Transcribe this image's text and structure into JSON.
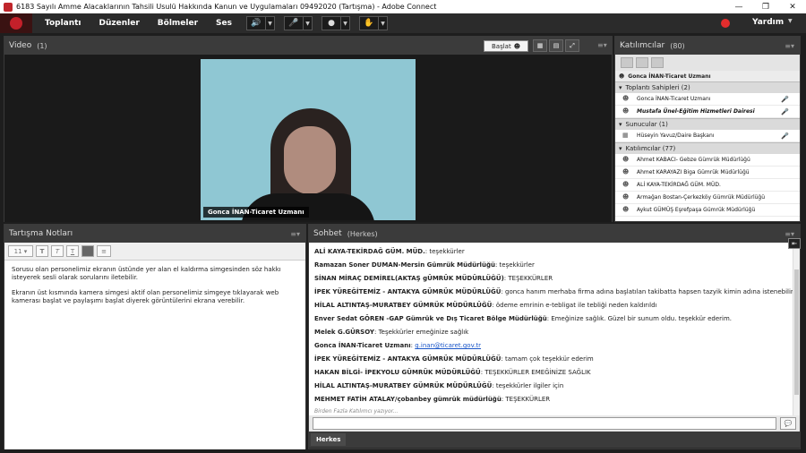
{
  "window": {
    "title": "6183 Sayılı Amme Alacaklarının Tahsili Usulü Hakkında Kanun ve Uygulamaları 09492020 (Tartışma) - Adobe Connect"
  },
  "menu": {
    "items": [
      "Toplantı",
      "Düzenler",
      "Bölmeler",
      "Ses"
    ],
    "help": "Yardım"
  },
  "video": {
    "title": "Video",
    "count": "(1)",
    "start": "Başlat",
    "label": "Gonca İNAN-Ticaret Uzmanı"
  },
  "attendees": {
    "title": "Katılımcılar",
    "count": "(80)",
    "top_name": "Gonca İNAN-Ticaret Uzmanı",
    "hosts_title": "Toplantı Sahipleri (2)",
    "hosts": [
      "Gonca İNAN-Ticaret Uzmanı",
      "Mustafa Ünel-Eğitim Hizmetleri Dairesi"
    ],
    "presenters_title": "Sunucular (1)",
    "presenters": [
      "Hüseyin Yavuz/Daire Başkanı"
    ],
    "participants_title": "Katılımcılar (77)",
    "participants": [
      "Ahmet KABACI- Gebze Gümrük Müdürlüğü",
      "Ahmet KARAYAZI Biga Gümrük Müdürlüğü",
      "ALİ KAYA-TEKİRDAĞ GÜM. MÜD.",
      "Armağan Bostan-Çerkezköy Gümrük Müdürlüğü",
      "Aykut GÜMÜŞ Eşrefpaşa Gümrük Müdürlüğü"
    ]
  },
  "notes": {
    "title": "Tartışma Notları",
    "font_size": "11",
    "paragraphs": [
      "Sorusu olan personelimiz ekranın üstünde yer alan el kaldırma simgesinden söz hakkı isteyerek sesli olarak sorularını iletebilir.",
      "Ekranın üst kısmında kamera simgesi aktif olan personelimiz simgeye tıklayarak web kamerası başlat ve paylaşımı başlat diyerek görüntülerini ekrana verebilir."
    ]
  },
  "chat": {
    "title": "Sohbet",
    "scope": "(Herkes)",
    "messages": [
      {
        "sender": "ALİ KAYA-TEKİRDAĞ GÜM. MÜD.",
        "text": ": teşekkürler"
      },
      {
        "sender": "Ramazan Soner DUMAN-Mersin Gümrük Müdürlüğü",
        "text": ": teşekkürler"
      },
      {
        "sender": "SİNAN MİRAÇ DEMİREL(AKTAŞ gÜMRÜK MÜDÜRLÜĞÜ)",
        "text": ": TEŞEKKÜRLER"
      },
      {
        "sender": "İPEK YÜREĞİTEMİZ - ANTAKYA GÜMRÜK MÜDÜRLÜĞÜ",
        "text": ": gonca hanım merhaba firma adına başlatılan takibatta hapsen tazyik kimin adına istenebilir"
      },
      {
        "sender": "HİLAL ALTINTAŞ-MURATBEY GÜMRÜK MÜDÜRLÜĞÜ",
        "text": ": ödeme emrinin e-tebligat ile tebliği neden kaldırıldı"
      },
      {
        "sender": "Enver Sedat GÖREN -GAP Gümrük ve Dış Ticaret Bölge Müdürlüğü",
        "text": ": Emeğinize sağlık. Güzel bir sunum oldu. teşekkür ederim."
      },
      {
        "sender": "Melek G.GÜRSOY",
        "text": ": Teşekkürler emeğinize sağlık"
      },
      {
        "sender": "Gonca İNAN-Ticaret Uzmanı",
        "text": ": ",
        "link": "g.inan@ticaret.gov.tr"
      },
      {
        "sender": "İPEK YÜREĞİTEMİZ - ANTAKYA GÜMRÜK MÜDÜRLÜĞÜ",
        "text": ": tamam çok teşekkür ederim"
      },
      {
        "sender": "HAKAN BİLGİ- İPEKYOLU GÜMRÜK MÜDÜRLÜĞÜ",
        "text": ": TEŞEKKÜRLER  EMEĞİNİZE SAĞLIK"
      },
      {
        "sender": "HİLAL ALTINTAŞ-MURATBEY GÜMRÜK MÜDÜRLÜĞÜ",
        "text": ": teşekkürler ilgiler için"
      },
      {
        "sender": "MEHMET FATİH ATALAY/çobanbey gümrük müdürlüğü",
        "text": ": TEŞEKKÜRLER"
      }
    ],
    "typing": "Birden Fazla Katılımcı yazıyor...",
    "footer_tab": "Herkes"
  }
}
